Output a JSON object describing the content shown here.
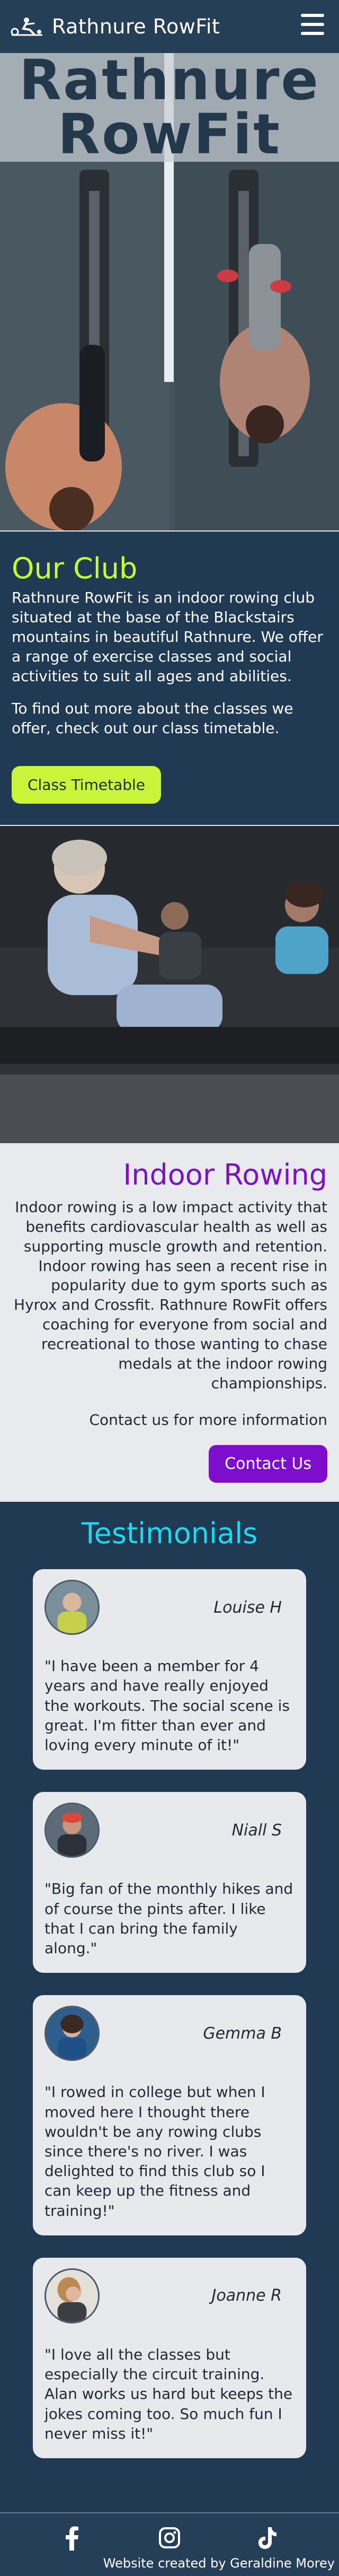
{
  "nav": {
    "brand": "Rathnure RowFit",
    "logo_icon": "rower-icon",
    "menu_icon": "hamburger-icon"
  },
  "hero": {
    "title_line1": "Rathnure",
    "title_line2": "RowFit"
  },
  "club": {
    "heading": "Our Club",
    "paragraph1": "Rathnure RowFit is an indoor rowing club situated at the base of the Blackstairs mountains in beautiful Rathnure. We offer a range of exercise classes and social activities to suit all ages and abilities.",
    "paragraph2": "To find out more about the classes we offer, check out our class timetable.",
    "button": "Class Timetable"
  },
  "rowing": {
    "heading": "Indoor Rowing",
    "paragraph": "Indoor rowing is a low impact activity that benefits cardiovascular health as well as supporting muscle growth and retention. Indoor rowing has seen a recent rise in popularity due to gym sports such as Hyrox and Crossfit. Rathnure RowFit offers coaching for everyone from social and recreational to those wanting to chase medals at the indoor rowing championships.",
    "contact_line": "Contact us for more information",
    "button": "Contact Us"
  },
  "testimonials": {
    "heading": "Testimonials",
    "items": [
      {
        "name": "Louise H",
        "quote": "\"I have been a member for 4 years and have really enjoyed the workouts. The social scene is great. I'm fitter than ever and loving every minute of it!\""
      },
      {
        "name": "Niall S",
        "quote": "\"Big fan of the monthly hikes and of course the pints after. I like that I can bring the family along.\""
      },
      {
        "name": "Gemma B",
        "quote": "\"I rowed in college but when I moved here I thought there wouldn't be any rowing clubs since there's no river. I was delighted to find this club so I can keep up the fitness and training!\""
      },
      {
        "name": "Joanne R",
        "quote": "\"I love all the classes but especially the circuit training. Alan works us hard but keeps the jokes coming too. So much fun I never miss it!\""
      }
    ]
  },
  "footer": {
    "credit": "Website created by Geraldine Morey",
    "social_icons": [
      "facebook-icon",
      "instagram-icon",
      "tiktok-icon"
    ]
  },
  "colors": {
    "navy": "#1f3a52",
    "lime": "#c8f43a",
    "purple": "#7d0ecb",
    "cyan": "#1ed8f0"
  }
}
